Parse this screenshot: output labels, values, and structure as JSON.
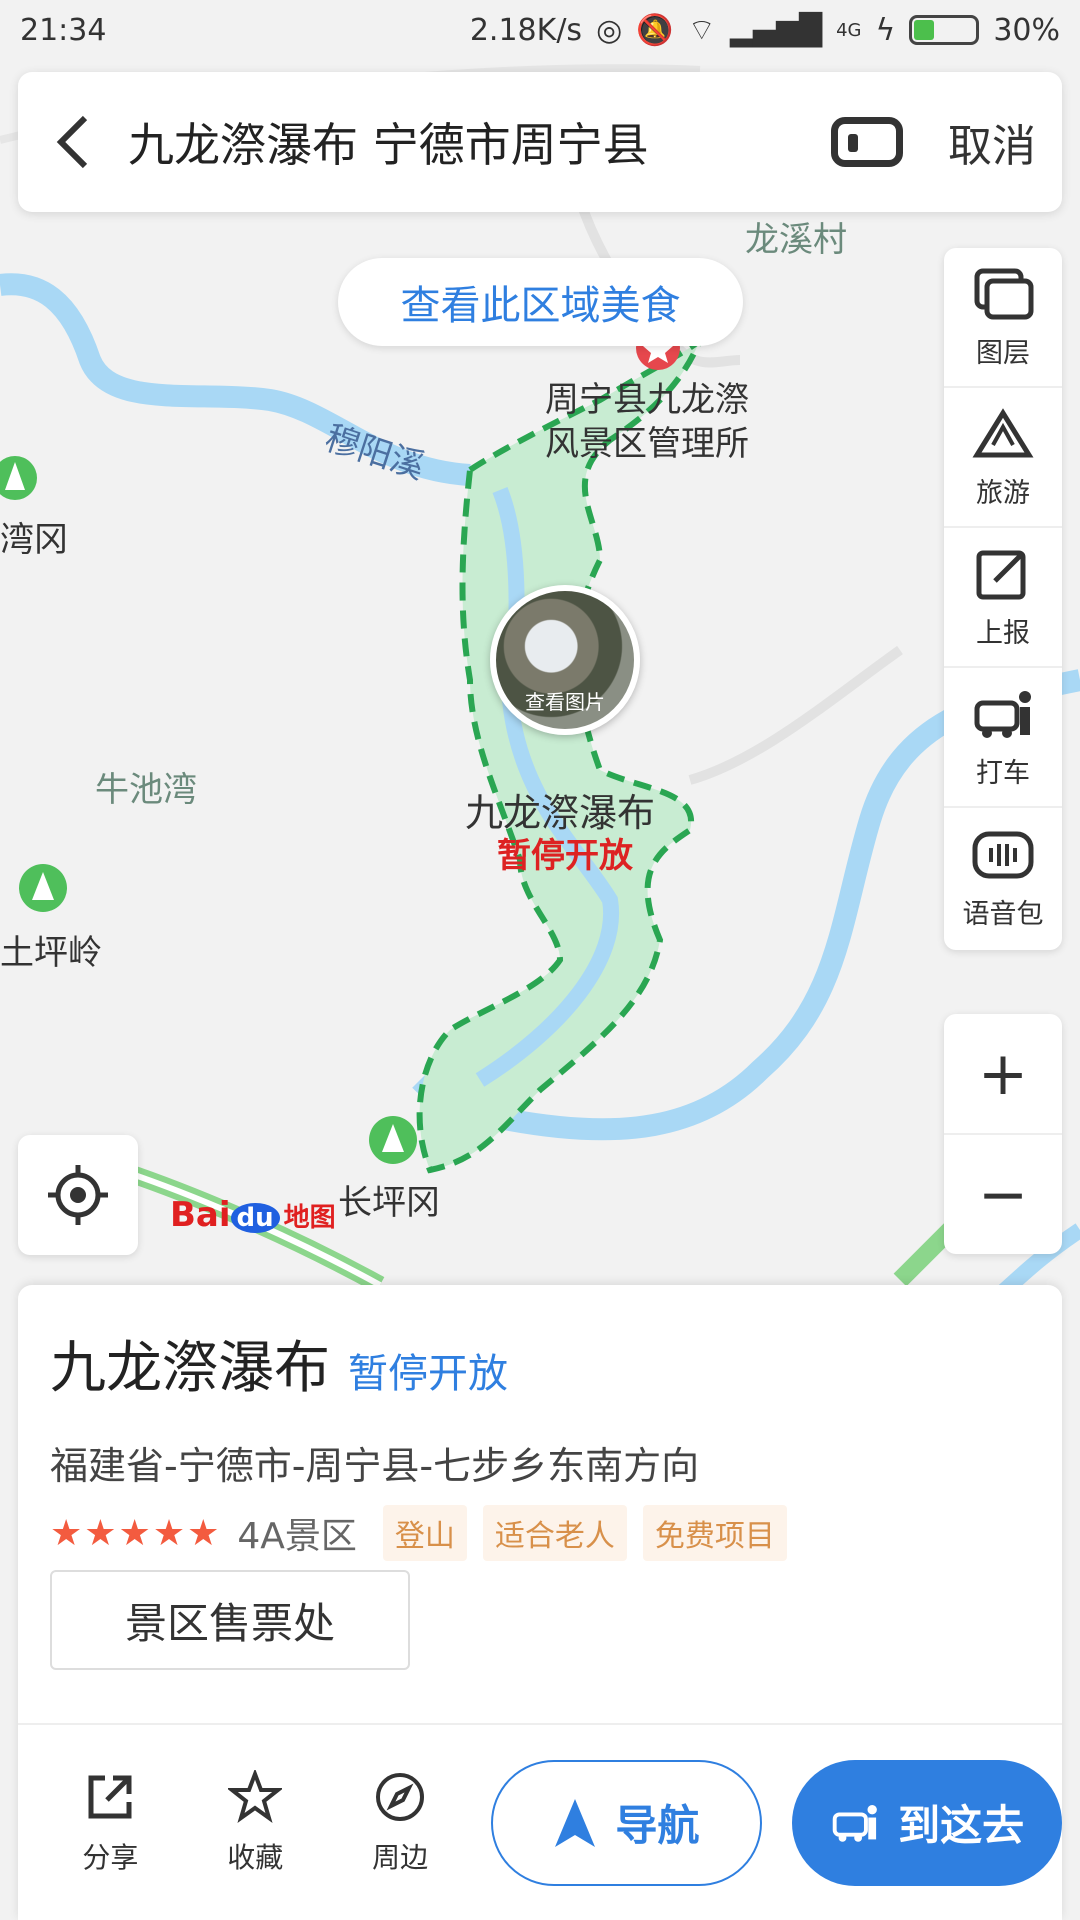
{
  "status_bar": {
    "time": "21:34",
    "speed": "2.18K/s",
    "network": "4G",
    "battery": "30%"
  },
  "search": {
    "query": "九龙漈瀑布 宁德市周宁县",
    "cancel_label": "取消"
  },
  "map": {
    "food_button": "查看此区域美食",
    "labels": {
      "longxi": "龙溪村",
      "office_line1": "周宁县九龙漈",
      "office_line2": "风景区管理所",
      "muyang": "穆阳溪",
      "wangang": "湾冈",
      "niuchiwan": "牛池湾",
      "tupingling": "土坪岭",
      "changpinggang": "长坪冈",
      "poi_name": "九龙漈瀑布",
      "poi_status": "暂停开放",
      "photo_caption": "查看图片"
    },
    "logo_bai": "Bai",
    "logo_du": "du",
    "logo_ditu": "地图"
  },
  "tools": [
    {
      "label": "图层",
      "icon": "layers-icon"
    },
    {
      "label": "旅游",
      "icon": "travel-icon"
    },
    {
      "label": "上报",
      "icon": "report-icon"
    },
    {
      "label": "打车",
      "icon": "taxi-icon"
    },
    {
      "label": "语音包",
      "icon": "voice-pack-icon"
    }
  ],
  "zoom": {
    "in": "+",
    "out": "−"
  },
  "place": {
    "name": "九龙漈瀑布",
    "status": "暂停开放",
    "address": "福建省-宁德市-周宁县-七步乡东南方向",
    "stars": "★★★★★",
    "rating": 5,
    "level": "4A景区",
    "tags": [
      "登山",
      "适合老人",
      "免费项目"
    ],
    "ticket_label": "景区售票处"
  },
  "actions": {
    "share": "分享",
    "favorite": "收藏",
    "nearby": "周边",
    "navigate": "导航",
    "go_there": "到这去"
  },
  "colors": {
    "accent": "#2f7fe0",
    "status_red": "#d22",
    "area_green": "#2aa652",
    "river": "#a9d8f5"
  }
}
